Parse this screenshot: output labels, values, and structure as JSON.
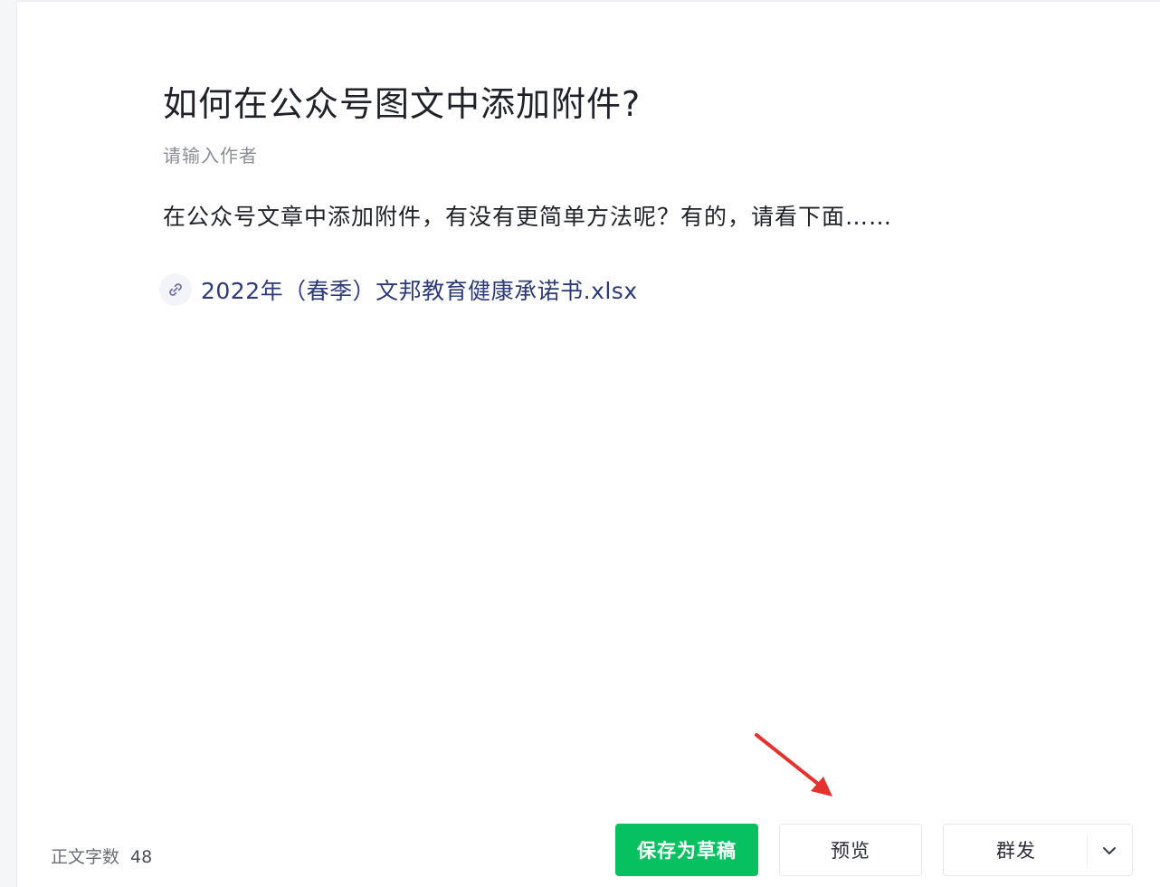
{
  "article": {
    "title": "如何在公众号图文中添加附件?",
    "author_placeholder": "请输入作者",
    "body": "在公众号文章中添加附件，有没有更简单方法呢？有的，请看下面……",
    "attachment": {
      "icon": "link-icon",
      "filename": "2022年（春季）文邦教育健康承诺书.xlsx"
    }
  },
  "footer": {
    "wordcount_label": "正文字数",
    "wordcount_value": "48",
    "save_draft_label": "保存为草稿",
    "preview_label": "预览",
    "publish_label": "群发",
    "publish_more_icon": "chevron-down-icon"
  },
  "colors": {
    "primary_green": "#07c160",
    "annotation_arrow": "#e5322d",
    "attachment_text": "#2c3a7a"
  }
}
